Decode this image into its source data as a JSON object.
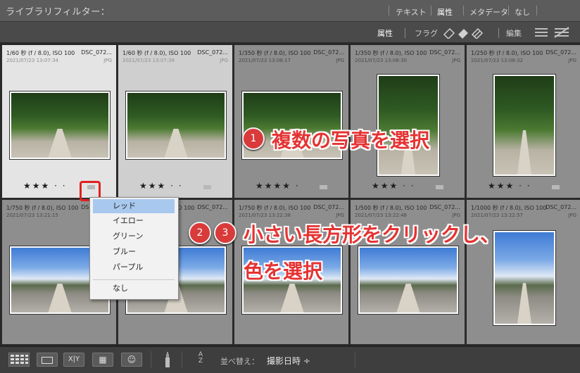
{
  "filter_bar": {
    "title": "ライブラリフィルター：",
    "tabs": [
      "テキスト",
      "属性",
      "メタデータ",
      "なし"
    ],
    "active_tab": "属性"
  },
  "attribute_bar": {
    "label": "属性",
    "flag_label": "フラグ",
    "edit_label": "編集"
  },
  "thumbnails": [
    {
      "exp": "1/60 秒 (f / 8.0), ISO 100",
      "file": "DSC_072...",
      "date": "2021/07/23 13:07:34",
      "ext": "JPG",
      "stars": "★★★ · ·",
      "kind": "trees",
      "state": "sel1"
    },
    {
      "exp": "1/60 秒 (f / 8.0), ISO 100",
      "file": "DSC_072...",
      "date": "2021/07/23 13:07:39",
      "ext": "JPG",
      "stars": "★★★ · ·",
      "kind": "trees",
      "state": "sel2"
    },
    {
      "exp": "1/350 秒 (f / 8.0), ISO 100",
      "file": "DSC_072...",
      "date": "2021/07/23 13:08:17",
      "ext": "JPG",
      "stars": "★★★★ ·",
      "kind": "trees",
      "state": ""
    },
    {
      "exp": "1/350 秒 (f / 8.0), ISO 100",
      "file": "DSC_072...",
      "date": "2021/07/23 13:08:30",
      "ext": "JPG",
      "stars": "★★★ · ·",
      "kind": "trees",
      "state": ""
    },
    {
      "exp": "1/250 秒 (f / 8.0), ISO 100",
      "file": "DSC_072...",
      "date": "2021/07/23 13:08:32",
      "ext": "JPG",
      "stars": "★★★ · ·",
      "kind": "trees",
      "state": ""
    },
    {
      "exp": "1/750 秒 (f / 8.0), ISO 100",
      "file": "DSC_072...",
      "date": "2021/07/23 13:21:15",
      "ext": "",
      "stars": "",
      "kind": "sky",
      "state": ""
    },
    {
      "exp": "1/750 秒 (f / 8.0), ISO 100",
      "file": "DSC_072...",
      "date": "",
      "ext": "",
      "stars": "",
      "kind": "sky",
      "state": ""
    },
    {
      "exp": "1/750 秒 (f / 8.0), ISO 100",
      "file": "DSC_072...",
      "date": "2021/07/23 13:22:38",
      "ext": "JPG",
      "stars": "",
      "kind": "sky",
      "state": ""
    },
    {
      "exp": "1/500 秒 (f / 8.0), ISO 100",
      "file": "DSC_072...",
      "date": "2021/07/23 13:22:48",
      "ext": "JPG",
      "stars": "",
      "kind": "sky",
      "state": ""
    },
    {
      "exp": "1/1000 秒 (f / 8.0), ISO 100",
      "file": "DSC_072...",
      "date": "2021/07/23 13:22:57",
      "ext": "JPG",
      "stars": "",
      "kind": "sky",
      "state": ""
    }
  ],
  "annotations": {
    "step1_badge": "1",
    "step1_text": "複数の写真を選択",
    "step2_badge": "2",
    "step3_badge": "3",
    "step23_text_line1": "小さい長方形をクリックし、",
    "step23_text_line2": "色を選択"
  },
  "color_menu": {
    "items": [
      "レッド",
      "イエロー",
      "グリーン",
      "ブルー",
      "パープル"
    ],
    "none_label": "なし",
    "highlighted": "レッド"
  },
  "toolbar": {
    "sort_label": "並べ替え：",
    "sort_value": "撮影日時 ÷",
    "loupe_xy": "X|Y",
    "az_icon": "A Z"
  }
}
